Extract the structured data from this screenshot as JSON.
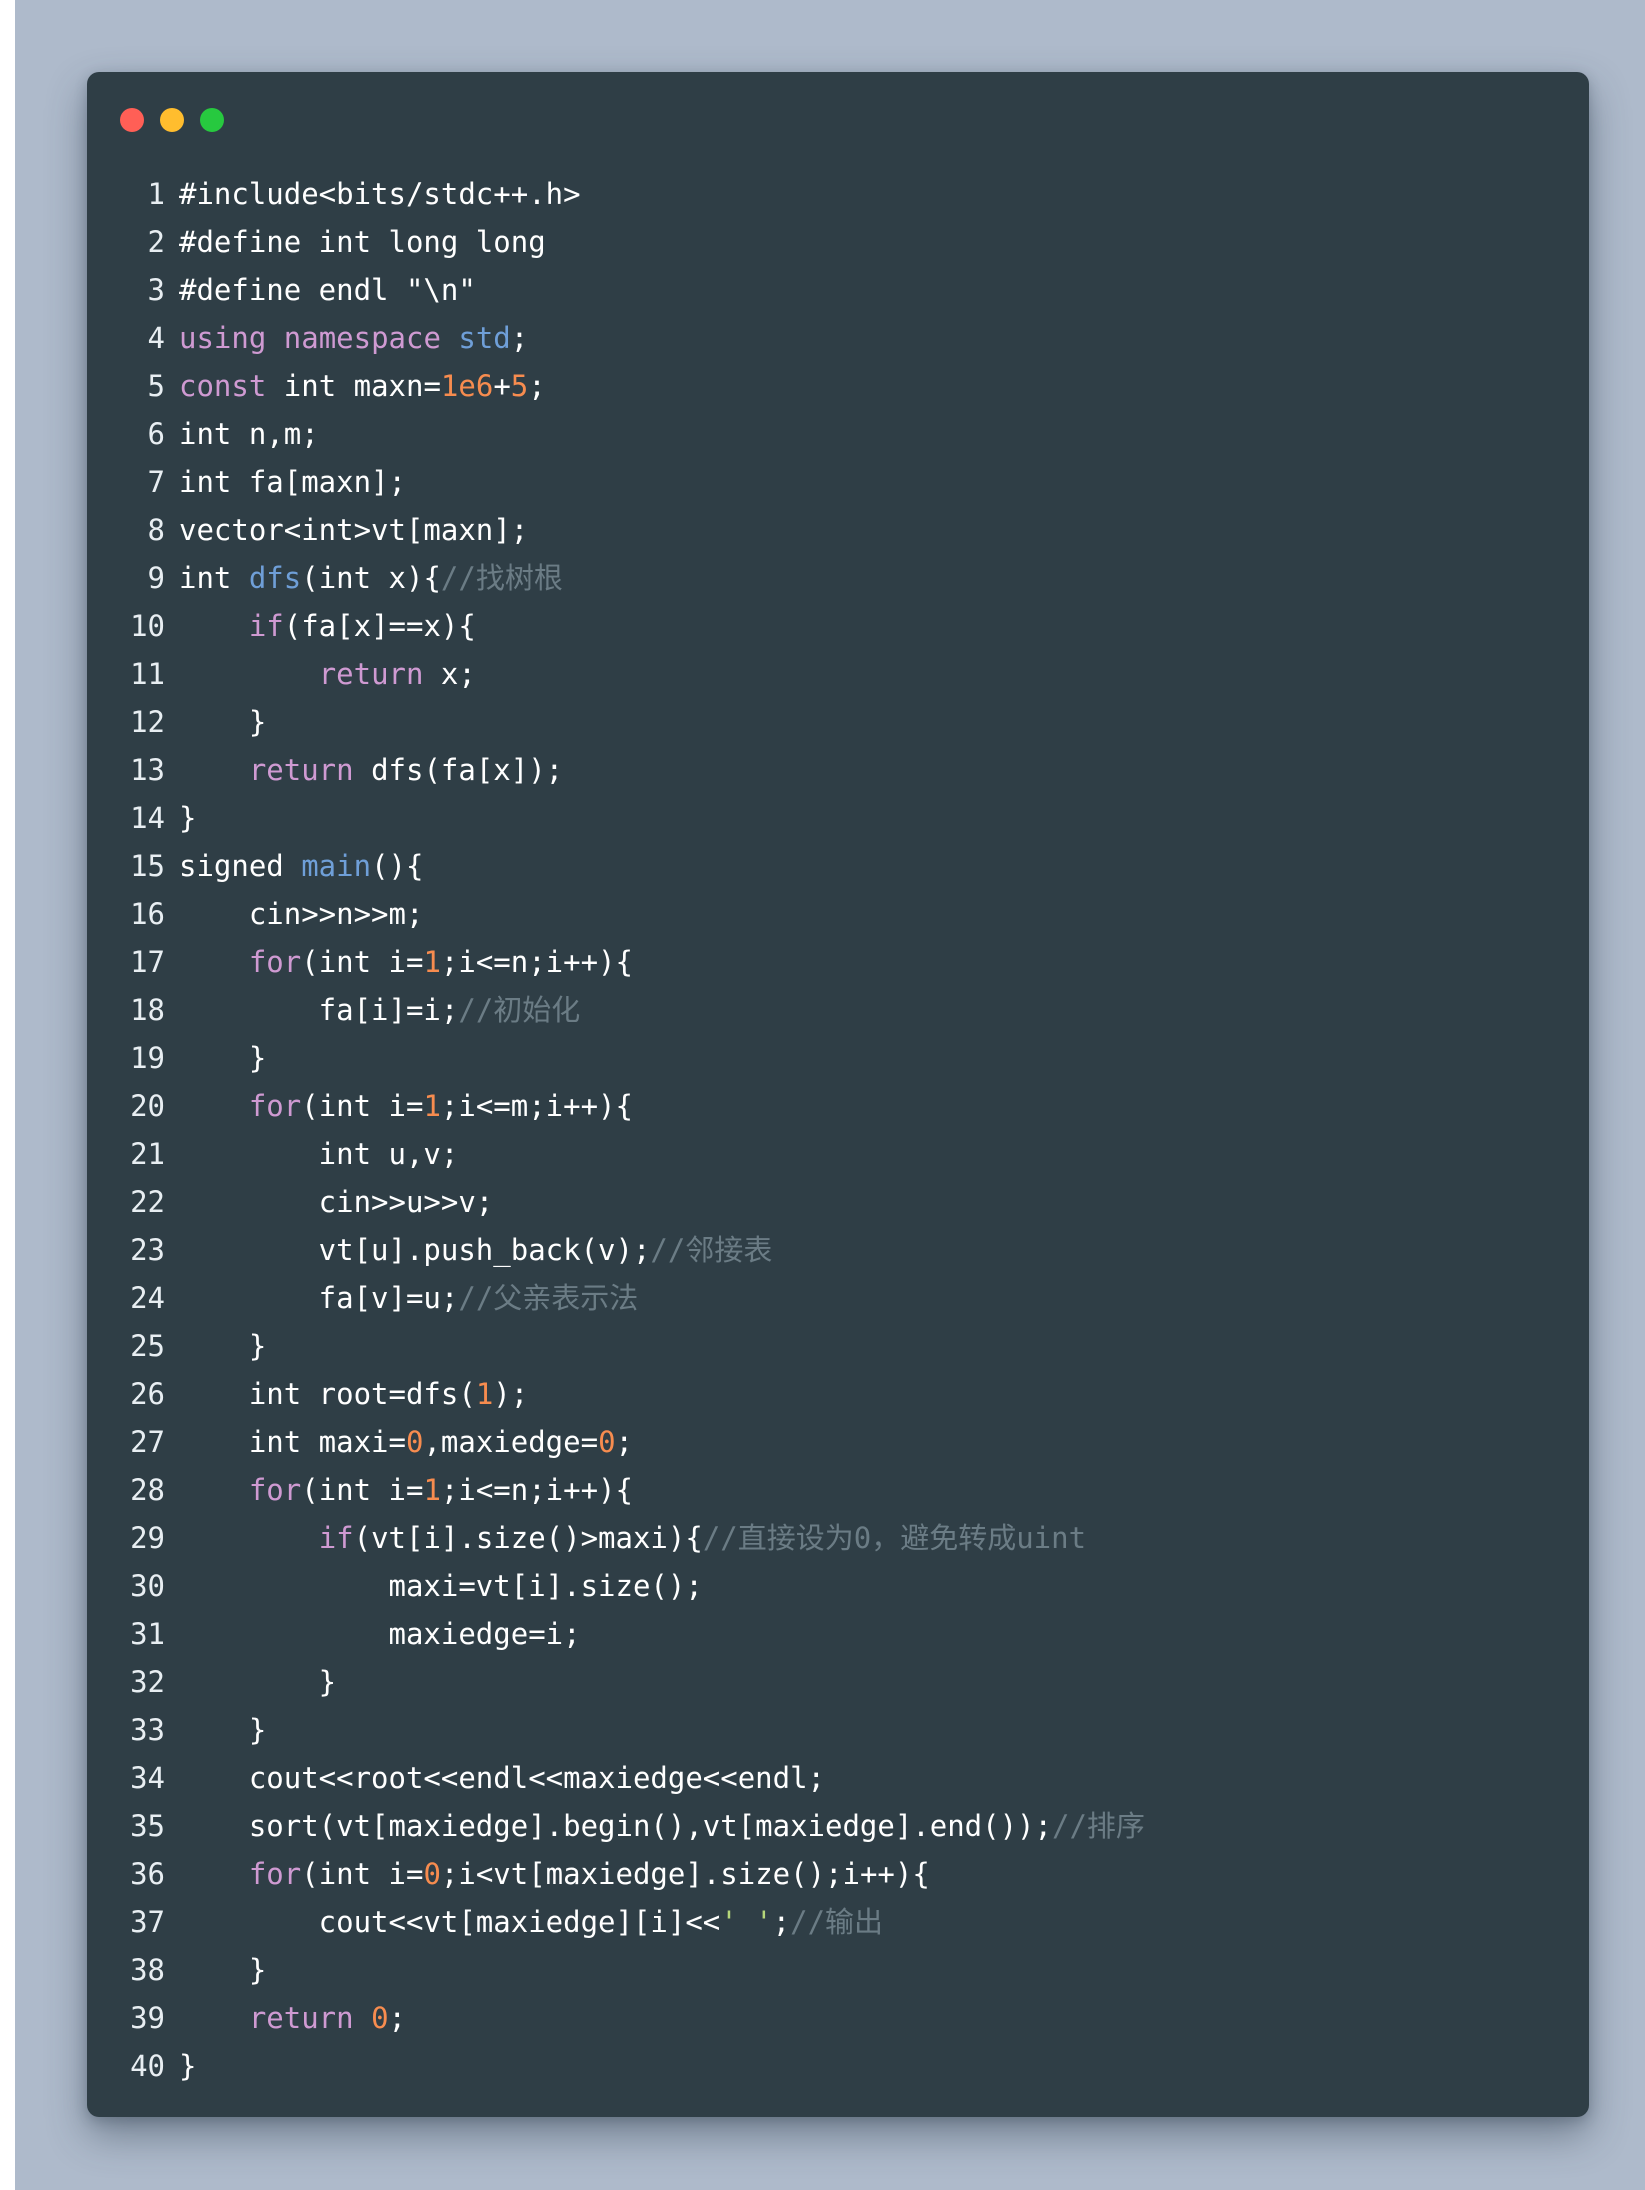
{
  "window": {
    "controls": [
      "close",
      "minimize",
      "maximize"
    ]
  },
  "code": {
    "lines": [
      {
        "n": "1",
        "tokens": [
          {
            "t": "#include<bits/stdc++.h>",
            "c": "pl"
          }
        ]
      },
      {
        "n": "2",
        "tokens": [
          {
            "t": "#define int long long",
            "c": "pl"
          }
        ]
      },
      {
        "n": "3",
        "tokens": [
          {
            "t": "#define endl \"\\n\"",
            "c": "pl"
          }
        ]
      },
      {
        "n": "4",
        "tokens": [
          {
            "t": "using",
            "c": "kw"
          },
          {
            "t": " ",
            "c": "pl"
          },
          {
            "t": "namespace",
            "c": "kw"
          },
          {
            "t": " ",
            "c": "pl"
          },
          {
            "t": "std",
            "c": "fn"
          },
          {
            "t": ";",
            "c": "pl"
          }
        ]
      },
      {
        "n": "5",
        "tokens": [
          {
            "t": "const",
            "c": "kw"
          },
          {
            "t": " int maxn=",
            "c": "pl"
          },
          {
            "t": "1e6",
            "c": "num"
          },
          {
            "t": "+",
            "c": "pl"
          },
          {
            "t": "5",
            "c": "num"
          },
          {
            "t": ";",
            "c": "pl"
          }
        ]
      },
      {
        "n": "6",
        "tokens": [
          {
            "t": "int n,m;",
            "c": "pl"
          }
        ]
      },
      {
        "n": "7",
        "tokens": [
          {
            "t": "int fa[maxn];",
            "c": "pl"
          }
        ]
      },
      {
        "n": "8",
        "tokens": [
          {
            "t": "vector<int>vt[maxn];",
            "c": "pl"
          }
        ]
      },
      {
        "n": "9",
        "tokens": [
          {
            "t": "int ",
            "c": "pl"
          },
          {
            "t": "dfs",
            "c": "fn"
          },
          {
            "t": "(int x){",
            "c": "pl"
          },
          {
            "t": "//找树根",
            "c": "cm"
          }
        ]
      },
      {
        "n": "10",
        "tokens": [
          {
            "t": "    ",
            "c": "pl"
          },
          {
            "t": "if",
            "c": "kw"
          },
          {
            "t": "(fa[x]==x){",
            "c": "pl"
          }
        ]
      },
      {
        "n": "11",
        "tokens": [
          {
            "t": "        ",
            "c": "pl"
          },
          {
            "t": "return",
            "c": "kw"
          },
          {
            "t": " x;",
            "c": "pl"
          }
        ]
      },
      {
        "n": "12",
        "tokens": [
          {
            "t": "    }",
            "c": "pl"
          }
        ]
      },
      {
        "n": "13",
        "tokens": [
          {
            "t": "    ",
            "c": "pl"
          },
          {
            "t": "return",
            "c": "kw"
          },
          {
            "t": " dfs(fa[x]);",
            "c": "pl"
          }
        ]
      },
      {
        "n": "14",
        "tokens": [
          {
            "t": "}",
            "c": "pl"
          }
        ]
      },
      {
        "n": "15",
        "tokens": [
          {
            "t": "signed ",
            "c": "pl"
          },
          {
            "t": "main",
            "c": "fn"
          },
          {
            "t": "(){",
            "c": "pl"
          }
        ]
      },
      {
        "n": "16",
        "tokens": [
          {
            "t": "    cin>>n>>m;",
            "c": "pl"
          }
        ]
      },
      {
        "n": "17",
        "tokens": [
          {
            "t": "    ",
            "c": "pl"
          },
          {
            "t": "for",
            "c": "kw"
          },
          {
            "t": "(int i=",
            "c": "pl"
          },
          {
            "t": "1",
            "c": "num"
          },
          {
            "t": ";i<=n;i++){",
            "c": "pl"
          }
        ]
      },
      {
        "n": "18",
        "tokens": [
          {
            "t": "        fa[i]=i;",
            "c": "pl"
          },
          {
            "t": "//初始化",
            "c": "cm"
          }
        ]
      },
      {
        "n": "19",
        "tokens": [
          {
            "t": "    }",
            "c": "pl"
          }
        ]
      },
      {
        "n": "20",
        "tokens": [
          {
            "t": "    ",
            "c": "pl"
          },
          {
            "t": "for",
            "c": "kw"
          },
          {
            "t": "(int i=",
            "c": "pl"
          },
          {
            "t": "1",
            "c": "num"
          },
          {
            "t": ";i<=m;i++){",
            "c": "pl"
          }
        ]
      },
      {
        "n": "21",
        "tokens": [
          {
            "t": "        int u,v;",
            "c": "pl"
          }
        ]
      },
      {
        "n": "22",
        "tokens": [
          {
            "t": "        cin>>u>>v;",
            "c": "pl"
          }
        ]
      },
      {
        "n": "23",
        "tokens": [
          {
            "t": "        vt[u].push_back(v);",
            "c": "pl"
          },
          {
            "t": "//邻接表",
            "c": "cm"
          }
        ]
      },
      {
        "n": "24",
        "tokens": [
          {
            "t": "        fa[v]=u;",
            "c": "pl"
          },
          {
            "t": "//父亲表示法",
            "c": "cm"
          }
        ]
      },
      {
        "n": "25",
        "tokens": [
          {
            "t": "    }",
            "c": "pl"
          }
        ]
      },
      {
        "n": "26",
        "tokens": [
          {
            "t": "    int root=dfs(",
            "c": "pl"
          },
          {
            "t": "1",
            "c": "num"
          },
          {
            "t": ");",
            "c": "pl"
          }
        ]
      },
      {
        "n": "27",
        "tokens": [
          {
            "t": "    int maxi=",
            "c": "pl"
          },
          {
            "t": "0",
            "c": "num"
          },
          {
            "t": ",maxiedge=",
            "c": "pl"
          },
          {
            "t": "0",
            "c": "num"
          },
          {
            "t": ";",
            "c": "pl"
          }
        ]
      },
      {
        "n": "28",
        "tokens": [
          {
            "t": "    ",
            "c": "pl"
          },
          {
            "t": "for",
            "c": "kw"
          },
          {
            "t": "(int i=",
            "c": "pl"
          },
          {
            "t": "1",
            "c": "num"
          },
          {
            "t": ";i<=n;i++){",
            "c": "pl"
          }
        ]
      },
      {
        "n": "29",
        "tokens": [
          {
            "t": "        ",
            "c": "pl"
          },
          {
            "t": "if",
            "c": "kw"
          },
          {
            "t": "(vt[i].size()>maxi){",
            "c": "pl"
          },
          {
            "t": "//直接设为0，避免转成uint",
            "c": "cm"
          }
        ]
      },
      {
        "n": "30",
        "tokens": [
          {
            "t": "            maxi=vt[i].size();",
            "c": "pl"
          }
        ]
      },
      {
        "n": "31",
        "tokens": [
          {
            "t": "            maxiedge=i;",
            "c": "pl"
          }
        ]
      },
      {
        "n": "32",
        "tokens": [
          {
            "t": "        }",
            "c": "pl"
          }
        ]
      },
      {
        "n": "33",
        "tokens": [
          {
            "t": "    }",
            "c": "pl"
          }
        ]
      },
      {
        "n": "34",
        "tokens": [
          {
            "t": "    cout<<root<<endl<<maxiedge<<endl;",
            "c": "pl"
          }
        ]
      },
      {
        "n": "35",
        "tokens": [
          {
            "t": "    sort(vt[maxiedge].begin(),vt[maxiedge].end());",
            "c": "pl"
          },
          {
            "t": "//排序",
            "c": "cm"
          }
        ]
      },
      {
        "n": "36",
        "tokens": [
          {
            "t": "    ",
            "c": "pl"
          },
          {
            "t": "for",
            "c": "kw"
          },
          {
            "t": "(int i=",
            "c": "pl"
          },
          {
            "t": "0",
            "c": "num"
          },
          {
            "t": ";i<vt[maxiedge].size();i++){",
            "c": "pl"
          }
        ]
      },
      {
        "n": "37",
        "tokens": [
          {
            "t": "        cout<<vt[maxiedge][i]<<",
            "c": "pl"
          },
          {
            "t": "' '",
            "c": "str"
          },
          {
            "t": ";",
            "c": "pl"
          },
          {
            "t": "//输出",
            "c": "cm"
          }
        ]
      },
      {
        "n": "38",
        "tokens": [
          {
            "t": "    }",
            "c": "pl"
          }
        ]
      },
      {
        "n": "39",
        "tokens": [
          {
            "t": "    ",
            "c": "pl"
          },
          {
            "t": "return",
            "c": "kw"
          },
          {
            "t": " ",
            "c": "pl"
          },
          {
            "t": "0",
            "c": "num"
          },
          {
            "t": ";",
            "c": "pl"
          }
        ]
      },
      {
        "n": "40",
        "tokens": [
          {
            "t": "}",
            "c": "pl"
          }
        ]
      }
    ]
  },
  "colors": {
    "background": "#aebacb",
    "window": "#2f3e46",
    "keyword": "#cf9ad2",
    "function": "#6f9fd8",
    "number": "#f78c4f",
    "comment": "#6b7c85",
    "string": "#b6d77a",
    "plain": "#ffffff"
  },
  "icons": {
    "close": "close-dot-icon",
    "minimize": "minimize-dot-icon",
    "maximize": "maximize-dot-icon"
  }
}
